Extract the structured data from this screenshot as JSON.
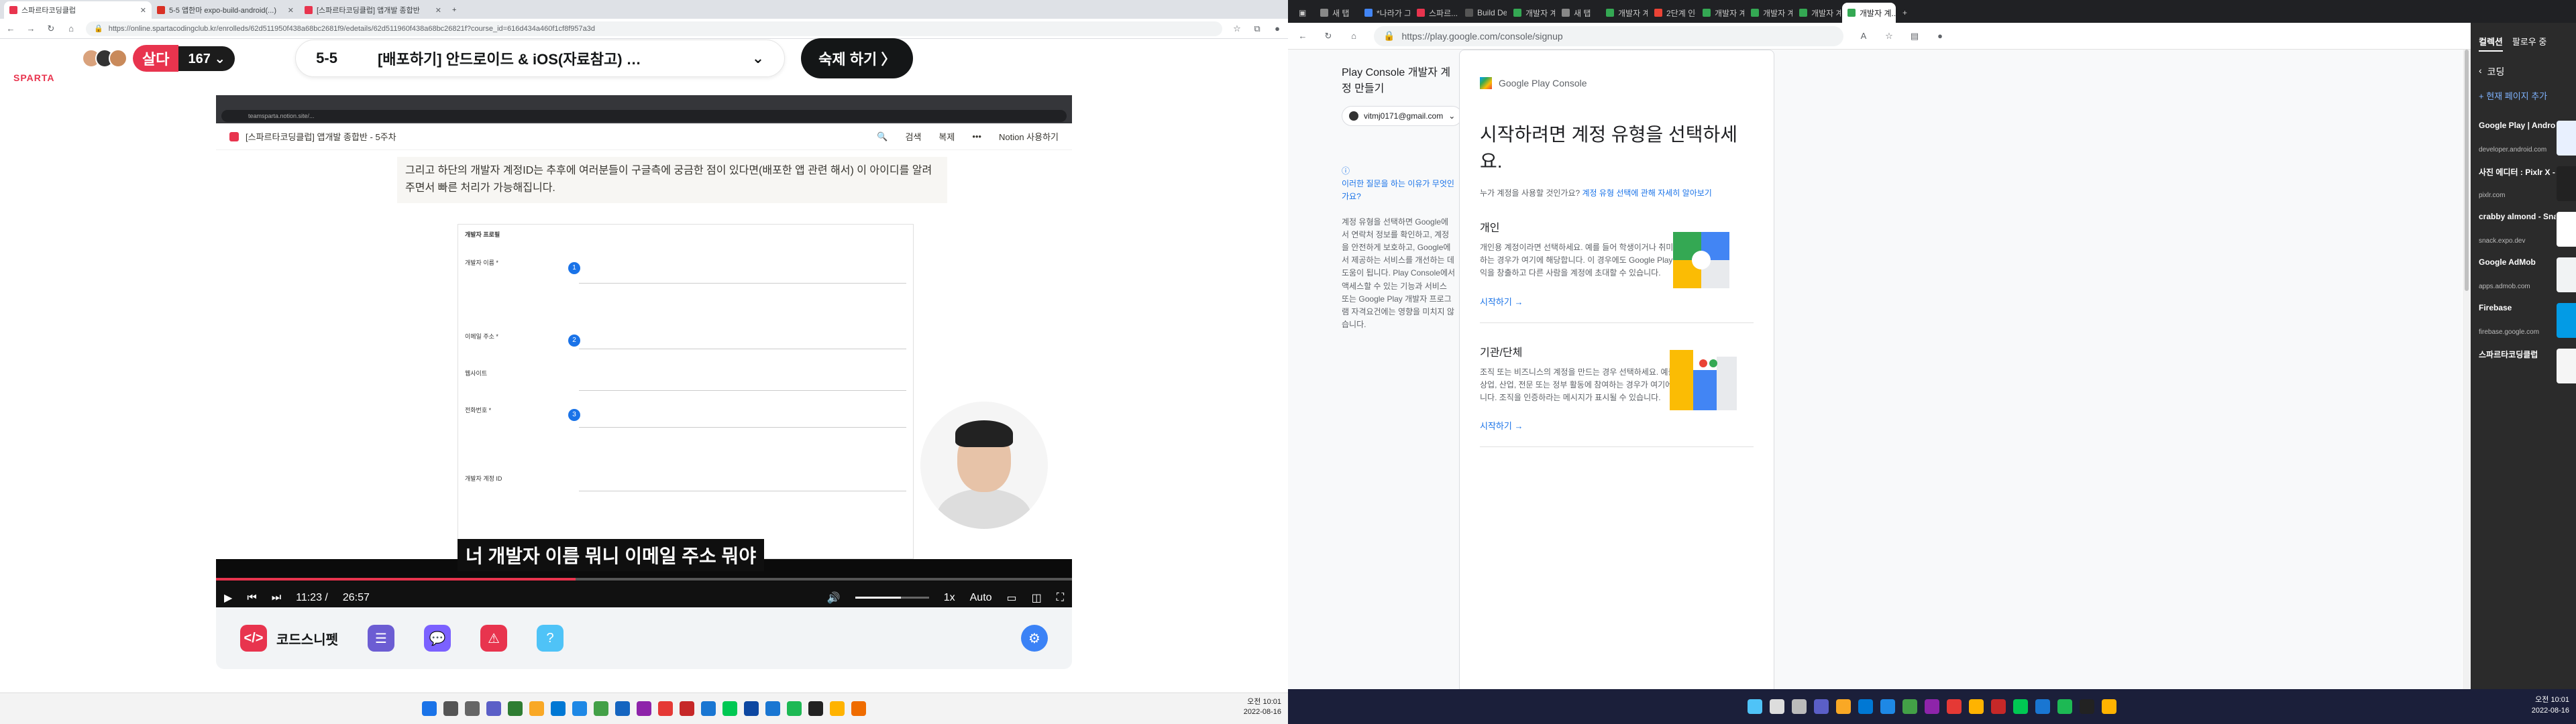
{
  "left_browser": {
    "tabs": [
      {
        "label": "스파르타코딩클럽",
        "color": "#e8344e"
      },
      {
        "label": "5-5 앱한마 expo-build-android(...)",
        "color": "#d93025"
      },
      {
        "label": "[스파르타코딩클럽] 앱개발 종합반",
        "color": "#e8344e"
      }
    ],
    "url": "https://online.spartacodingclub.kr/enrolleds/62d511950f438a68bc2681f9/edetails/62d511960f438a68bc26821f?course_id=616d434a460f1cf8f957a3d"
  },
  "sparta": {
    "logo": "SPARTA",
    "live_label": "살다",
    "viewer_count": "167 ⌄",
    "lecture_number": "5-5",
    "lecture_title": "[배포하기] 안드로이드 & iOS(자료참고) …",
    "homework_button": "숙제 하기 〉",
    "video": {
      "inner_url": "teamsparta.notion.site/...",
      "notion_path": "[스파르타코딩클럽] 앱개발 종합반 - 5주차",
      "notion_search": "검색",
      "notion_copy": "복제",
      "notion_use": "Notion 사용하기",
      "quote": "그리고 하단의 개발자 계정ID는 추후에 여러분들이 구글측에 궁금한 점이 있다면(배포한 앱 관련 해서) 이 아이디를 알려주면서 빠른 처리가 가능해집니다.",
      "form_title": "개발자 프로필",
      "form_fields": [
        "개발자 이름 *",
        "이메일 주소 *",
        "웹사이트",
        "전화번호 *",
        "개발자 계정 ID"
      ],
      "subtitle": "너 개발자 이름 뭐니 이메일 주소 뭐야",
      "current_time": "11:23 /",
      "duration": "26:57",
      "progress": 0.42,
      "speed": "1x",
      "quality": "Auto"
    },
    "bottom_label": "코드스니펫"
  },
  "left_clock": {
    "time": "오전 10:01",
    "date": "2022-08-16"
  },
  "right_browser": {
    "tabs": [
      {
        "label": "새 탭",
        "color": "#888"
      },
      {
        "label": "*나라가 그...",
        "color": "#4285f4"
      },
      {
        "label": "스파르...",
        "color": "#e8344e"
      },
      {
        "label": "Build De...",
        "color": "#555"
      },
      {
        "label": "개발자 계...",
        "color": "#34a853"
      },
      {
        "label": "새 탭",
        "color": "#888"
      },
      {
        "label": "개발자 계...",
        "color": "#34a853"
      },
      {
        "label": "2단계 인증",
        "color": "#ea4335"
      },
      {
        "label": "개발자 계...",
        "color": "#34a853"
      },
      {
        "label": "개발자 계...",
        "color": "#34a853"
      },
      {
        "label": "개발자 계...",
        "color": "#34a853"
      },
      {
        "label": "개발자 계...",
        "color": "#34a853"
      }
    ],
    "url": "https://play.google.com/console/signup"
  },
  "play_console": {
    "page_title": "Play Console 개발자 계정 만들기",
    "account": "vitmj0171@gmail.com",
    "why_link": "이러한 질문을 하는 이유가 무엇인가요?",
    "why_text": "계정 유형을 선택하면 Google에서 연락처 정보를 확인하고, 계정을 안전하게 보호하고, Google에서 제공하는 서비스를 개선하는 데 도움이 됩니다. Play Console에서 액세스할 수 있는 기능과 서비스 또는 Google Play 개발자 프로그램 자격요건에는 영향을 미치지 않습니다.",
    "brand": "Google Play Console",
    "heading": "시작하려면 계정 유형을 선택하세요.",
    "question": "누가 계정을 사용할 것인가요?",
    "question_link": "계정 유형 선택에 관해 자세히 알아보기",
    "personal_title": "개인",
    "personal_text": "개인용 계정이라면 선택하세요. 예를 들어 학생이거나 취미로 개발하는 경우가 여기에 해당합니다. 이 경우에도 Google Play에서 수익을 창출하고 다른 사람을 계정에 초대할 수 있습니다.",
    "personal_cta": "시작하기 →",
    "org_title": "기관/단체",
    "org_text": "조직 또는 비즈니스의 계정을 만드는 경우 선택하세요. 예를 들어 상업, 산업, 전문 또는 정부 활동에 참여하는 경우가 여기에 해당합니다. 조직을 인증하라는 메시지가 표시될 수 있습니다.",
    "org_cta": "시작하기 →"
  },
  "collections": {
    "tab_active": "컬렉션",
    "tab_other": "팔로우 중",
    "folder": "코딩",
    "add_current": "+ 현재 페이지 추가",
    "items": [
      {
        "title": "Google Play | Android D...",
        "domain": "developer.android.com",
        "thumb": "#e8f0fe"
      },
      {
        "title": "사진 에디터 : Pixlr X - 온라...",
        "domain": "pixlr.com",
        "thumb": "#222"
      },
      {
        "title": "crabby almond - Snack",
        "domain": "snack.expo.dev",
        "thumb": "#fff"
      },
      {
        "title": "Google AdMob",
        "domain": "apps.admob.com",
        "thumb": "#f1f3f4"
      },
      {
        "title": "Firebase",
        "domain": "firebase.google.com",
        "thumb": "#039be5"
      },
      {
        "title": "스파르타코딩클럽",
        "domain": "",
        "thumb": "#f5f5f5"
      }
    ]
  },
  "right_clock": {
    "time": "오전 10:01",
    "date": "2022-08-16"
  }
}
